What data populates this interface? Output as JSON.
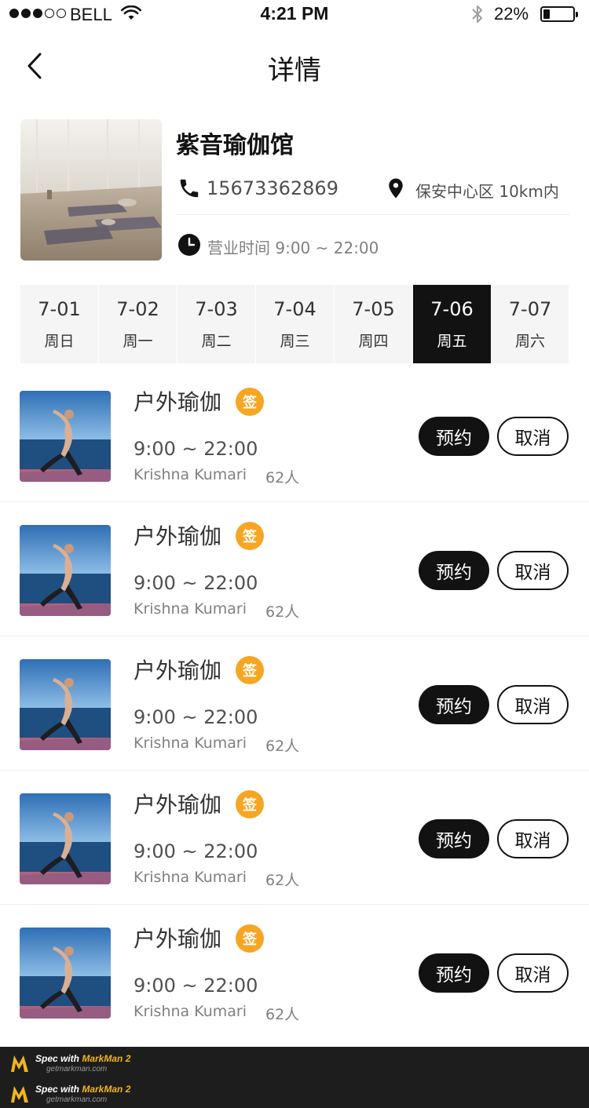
{
  "status_bar": {
    "signal_filled": 3,
    "signal_total": 5,
    "carrier": "BELL",
    "time": "4:21 PM",
    "battery_text": "22%",
    "battery_level": 0.22,
    "icons": [
      "wifi-icon",
      "bluetooth-icon",
      "battery-icon"
    ]
  },
  "nav": {
    "back_icon": "chevron-left-icon",
    "title": "详情"
  },
  "venue": {
    "name": "紫音瑜伽馆",
    "phone": "15673362869",
    "address": "保安中心区 10km内",
    "hours": "营业时间 9:00 ~ 22:00",
    "icons": [
      "phone-icon",
      "location-pin-icon",
      "clock-icon"
    ]
  },
  "dates": [
    {
      "date": "7-01",
      "weekday": "周日",
      "active": false
    },
    {
      "date": "7-02",
      "weekday": "周一",
      "active": false
    },
    {
      "date": "7-03",
      "weekday": "周二",
      "active": false
    },
    {
      "date": "7-04",
      "weekday": "周三",
      "active": false
    },
    {
      "date": "7-05",
      "weekday": "周四",
      "active": false
    },
    {
      "date": "7-06",
      "weekday": "周五",
      "active": true
    },
    {
      "date": "7-07",
      "weekday": "周六",
      "active": false
    }
  ],
  "classes": [
    {
      "name": "户外瑜伽",
      "badge": "签",
      "time": "9:00 ~ 22:00",
      "teacher": "Krishna Kumari",
      "count": "62人",
      "book_label": "预约",
      "cancel_label": "取消"
    },
    {
      "name": "户外瑜伽",
      "badge": "签",
      "time": "9:00 ~ 22:00",
      "teacher": "Krishna Kumari",
      "count": "62人",
      "book_label": "预约",
      "cancel_label": "取消"
    },
    {
      "name": "户外瑜伽",
      "badge": "签",
      "time": "9:00 ~ 22:00",
      "teacher": "Krishna Kumari",
      "count": "62人",
      "book_label": "预约",
      "cancel_label": "取消"
    },
    {
      "name": "户外瑜伽",
      "badge": "签",
      "time": "9:00 ~ 22:00",
      "teacher": "Krishna Kumari",
      "count": "62人",
      "book_label": "预约",
      "cancel_label": "取消"
    },
    {
      "name": "户外瑜伽",
      "badge": "签",
      "time": "9:00 ~ 22:00",
      "teacher": "Krishna Kumari",
      "count": "62人",
      "book_label": "预约",
      "cancel_label": "取消"
    }
  ],
  "watermark": {
    "line1_prefix": "Spec with ",
    "line1_brand": "MarkMan 2",
    "line2": "getmarkman.com"
  },
  "colors": {
    "primary": "#121212",
    "text_dark": "#333333",
    "text_medium": "#505050",
    "text_light": "#808080",
    "divider": "#eeeeee",
    "tab_bg": "#f5f5f5",
    "badge": "#f6a623"
  }
}
